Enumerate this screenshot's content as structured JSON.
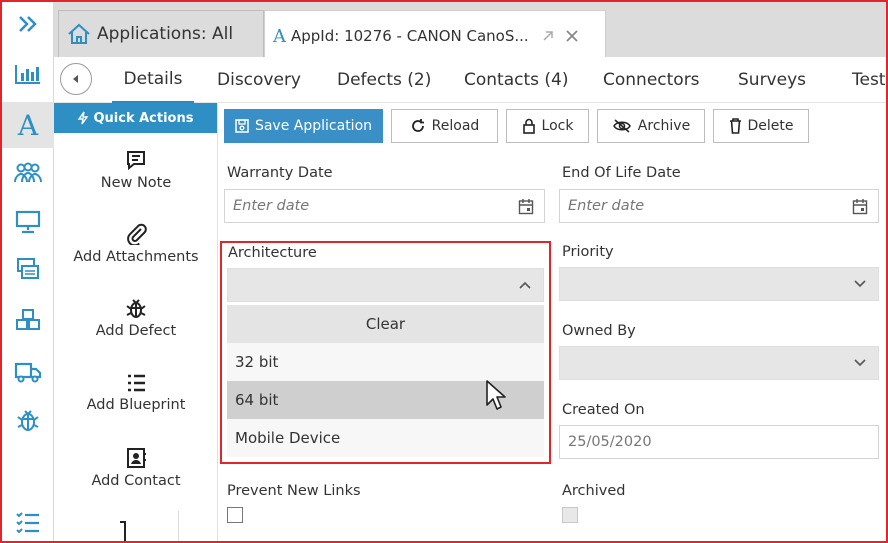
{
  "tabs": [
    {
      "label": "Applications: All",
      "icon": "home-icon"
    },
    {
      "label": "AppId: 10276 - CANON CanoS...",
      "icon": "app-a-icon"
    }
  ],
  "subtabs": [
    "Details",
    "Discovery",
    "Defects (2)",
    "Contacts (4)",
    "Connectors",
    "Surveys",
    "Testi"
  ],
  "quick_actions": {
    "title": "Quick Actions",
    "items": [
      {
        "label": "New Note",
        "icon": "note-icon"
      },
      {
        "label": "Add Attachments",
        "icon": "paperclip-icon"
      },
      {
        "label": "Add Defect",
        "icon": "bug-icon"
      },
      {
        "label": "Add Blueprint",
        "icon": "list-icon"
      },
      {
        "label": "Add Contact",
        "icon": "contact-icon"
      }
    ]
  },
  "toolbar": {
    "save": "Save Application",
    "reload": "Reload",
    "lock": "Lock",
    "archive": "Archive",
    "delete": "Delete"
  },
  "fields": {
    "warranty_date": {
      "label": "Warranty Date",
      "placeholder": "Enter date"
    },
    "end_of_life_date": {
      "label": "End Of Life Date",
      "placeholder": "Enter date"
    },
    "architecture": {
      "label": "Architecture",
      "value": ""
    },
    "priority": {
      "label": "Priority",
      "value": ""
    },
    "owned_by": {
      "label": "Owned By",
      "value": ""
    },
    "created_on": {
      "label": "Created On",
      "value": "25/05/2020"
    },
    "prevent_new_links": {
      "label": "Prevent New Links",
      "checked": false
    },
    "archived": {
      "label": "Archived",
      "checked": false
    }
  },
  "architecture_dropdown": {
    "clear_label": "Clear",
    "options": [
      "32 bit",
      "64 bit",
      "Mobile Device"
    ],
    "hovered": "64 bit"
  },
  "colors": {
    "accent": "#2e8fc4",
    "highlight_border": "#e0262b",
    "hover_row": "#cfcfcf"
  }
}
